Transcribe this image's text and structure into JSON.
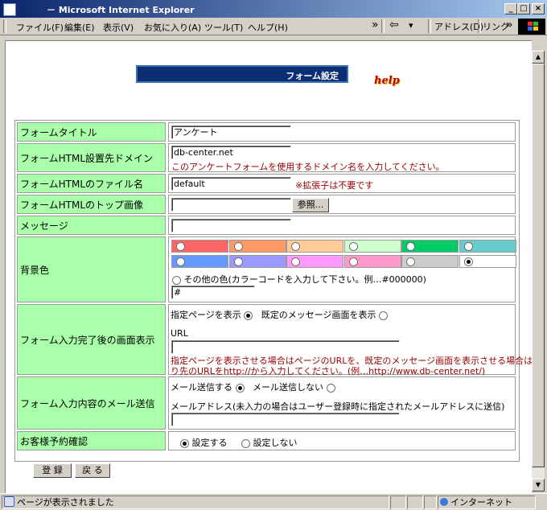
{
  "window": {
    "title": "－ Microsoft Internet Explorer",
    "btn_min": "_",
    "btn_max": "□",
    "btn_close": "×"
  },
  "menu": {
    "items": [
      "ファイル(F)",
      "編集(E)",
      "表示(V)",
      "お気に入り(A)",
      "ツール(T)",
      "ヘルプ(H)"
    ],
    "back": "⇦",
    "back_arrow": "▾",
    "more1": "»",
    "address_label": "アドレス(D)",
    "links_label": "リンク",
    "more2": "»"
  },
  "page": {
    "heading": "フォーム設定",
    "help": "help",
    "rows": {
      "title": {
        "label": "フォームタイトル",
        "value": "アンケート"
      },
      "domain": {
        "label": "フォームHTML設置先ドメイン",
        "value": "db-center.net",
        "note": "このアンケートフォームを使用するドメイン名を入力してください。"
      },
      "filename": {
        "label": "フォームHTMLのファイル名",
        "value": "default",
        "note": "※拡張子は不要です"
      },
      "topimage": {
        "label": "フォームHTMLのトップ画像",
        "value": "",
        "browse": "参照..."
      },
      "message": {
        "label": "メッセージ",
        "value": ""
      },
      "bgcolor": {
        "label": "背景色",
        "colors": [
          "#ff6666",
          "#ff9966",
          "#ffcc99",
          "#ccffcc",
          "#00cc66",
          "#66cccc",
          "#6699ff",
          "#9999ff",
          "#ff99ff",
          "#ff99cc",
          "#cccccc",
          "#ffffff"
        ],
        "selected_index": 11,
        "other_label": "その他の色(カラーコードを入力して下さい。例…#000000)",
        "other_value": "#"
      },
      "complete": {
        "label": "フォーム入力完了後の画面表示",
        "opt1": "指定ページを表示",
        "opt2": "既定のメッセージ画面を表示",
        "url_label": "URL",
        "url_value": "",
        "note1": "指定ページを表示させる場合はページのURLを、既定のメッセージ画面を表示させる場合は戻",
        "note2": "り先のURLをhttp://から入力してください。(例…http://www.db-center.net/)"
      },
      "mail": {
        "label": "フォーム入力内容のメール送信",
        "opt1": "メール送信する",
        "opt2": "メール送信しない",
        "addr_label": "メールアドレス(未入力の場合はユーザー登録時に指定されたメールアドレスに送信)",
        "addr_value": ""
      },
      "reserve": {
        "label": "お客様予約確認",
        "opt1": "設定する",
        "opt2": "設定しない"
      }
    },
    "buttons": {
      "register": "登 録",
      "back": "戻 る"
    }
  },
  "status": {
    "text": "ページが表示されました",
    "zone": "インターネット"
  }
}
